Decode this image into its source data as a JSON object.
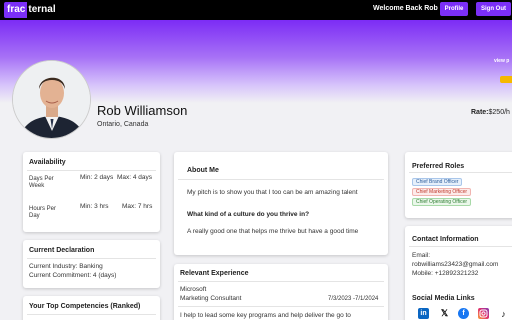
{
  "nav": {
    "logo_part1": "frac",
    "logo_part2": "ternal",
    "welcome": "Welcome Back Rob",
    "profile_label": "Profile",
    "signout_label": "Sign Out",
    "accent_color": "#7b2ff7"
  },
  "banner": {
    "view_link": "view p"
  },
  "profile": {
    "name": "Rob Williamson",
    "location": "Ontario, Canada",
    "rate_label": "Rate:",
    "rate_value": "$250/h"
  },
  "availability": {
    "title": "Availability",
    "days_label": "Days Per Week",
    "days_label_l1": "Days Per",
    "days_label_l2": "Week",
    "days_min": "Min: 2 days",
    "days_max": "Max: 4 days",
    "hours_label": "Hours Per Day",
    "hours_label_l1": "Hours Per",
    "hours_label_l2": "Day",
    "hours_min": "Min: 3 hrs",
    "hours_max": "Max: 7 hrs"
  },
  "declaration": {
    "title": "Current Declaration",
    "industry": "Current Industry: Banking",
    "commitment": "Current Commitment: 4 (days)"
  },
  "competencies": {
    "title": "Your Top Competencies (Ranked)"
  },
  "about": {
    "title": "About Me",
    "pitch": "My pitch is to show you that I too can be am amazing talent",
    "culture_q": "What kind of a culture do you thrive in?",
    "culture_a": "A really good one that helps me thrive but have a good time"
  },
  "experience": {
    "title": "Relevant Experience",
    "company": "Microsoft",
    "role": "Marketing Consultant",
    "dates": "7/3/2023 -7/1/2024",
    "description": "I help to lead some key programs and help deliver the go to"
  },
  "roles": {
    "title": "Preferred Roles",
    "items": [
      "Chief Brand Officer",
      "Chief Marketing Officer",
      "Chief Operating Officer"
    ]
  },
  "contact": {
    "title": "Contact Information",
    "email_label": "Email:",
    "email": "robwilliams23423@gmail.com",
    "mobile": "Mobile: +12892321232",
    "social_title": "Social Media Links",
    "social_icons": [
      "linkedin-icon",
      "x-icon",
      "facebook-icon",
      "instagram-icon",
      "tiktok-icon"
    ]
  }
}
